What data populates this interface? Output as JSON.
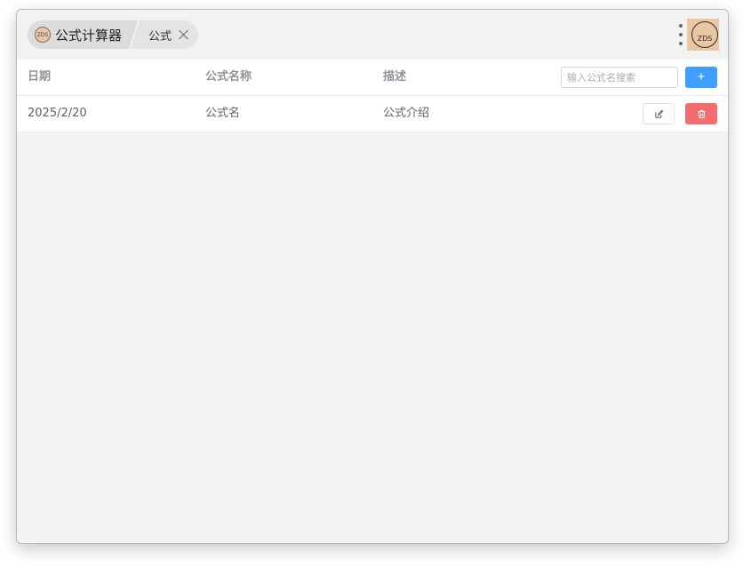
{
  "app": {
    "title": "公式计算器",
    "logo_text": "ZDS"
  },
  "tabs": [
    {
      "label": "公式",
      "closable": true
    }
  ],
  "user": {
    "avatar_text": "ZDS"
  },
  "table": {
    "columns": [
      "日期",
      "公式名称",
      "描述"
    ],
    "search_placeholder": "输入公式名搜索",
    "add_label": "+",
    "rows": [
      {
        "date": "2025/2/20",
        "name": "公式名",
        "description": "公式介绍"
      }
    ]
  },
  "icons": {
    "more": "more-vertical-icon",
    "close": "close-icon",
    "edit": "edit-icon",
    "delete": "trash-icon"
  },
  "colors": {
    "primary": "#409eff",
    "danger": "#f56c6c",
    "background": "#f3f3f3"
  }
}
